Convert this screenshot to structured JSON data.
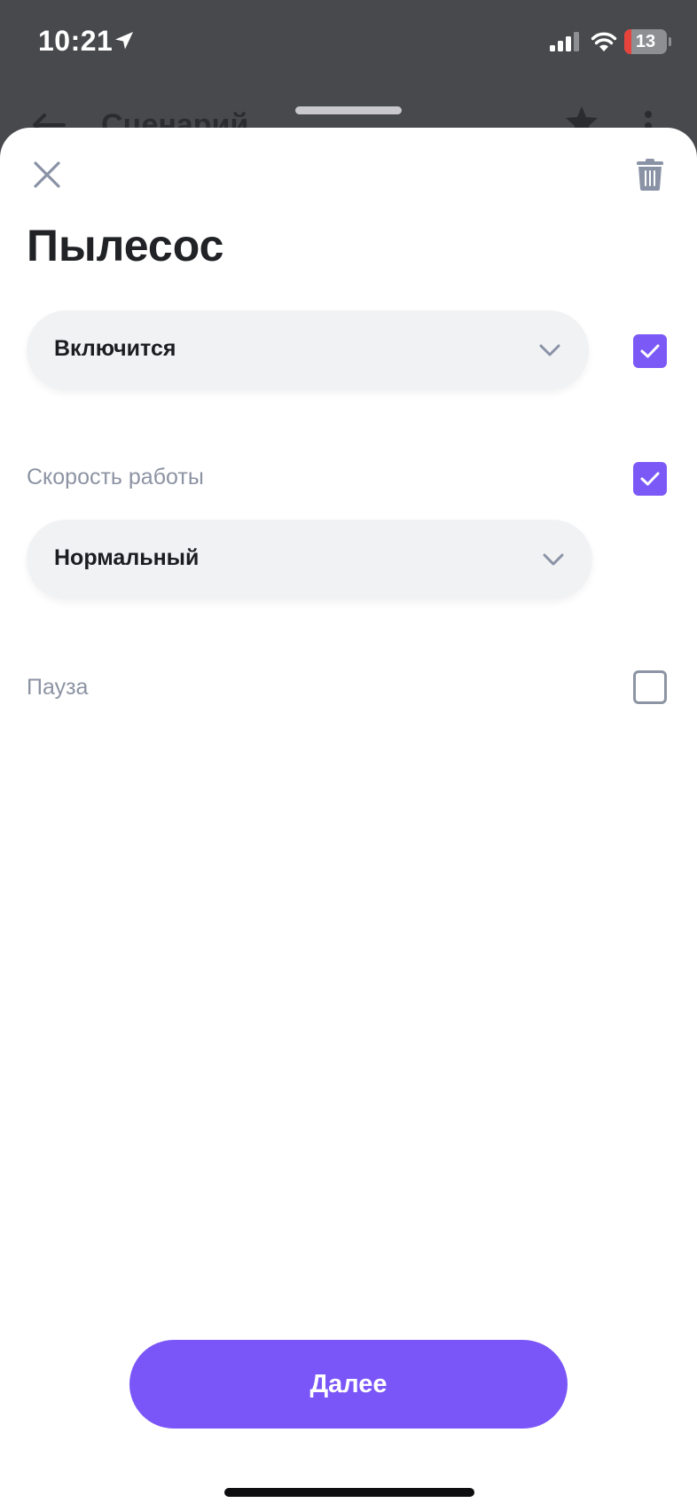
{
  "status_bar": {
    "time": "10:21",
    "location_icon": "location-arrow-icon",
    "signal_icon": "cellular-signal-icon",
    "wifi_icon": "wifi-icon",
    "battery_level": "13",
    "battery_color": "#e5433c"
  },
  "background_screen": {
    "title": "Сценарий",
    "back_icon": "arrow-left-icon",
    "star_icon": "star-icon",
    "more_icon": "more-vertical-icon"
  },
  "sheet": {
    "close_icon": "close-icon",
    "delete_icon": "trash-icon",
    "title": "Пылесос",
    "action_select": {
      "value": "Включится",
      "checked": true
    },
    "speed": {
      "label": "Скорость работы",
      "value": "Нормальный",
      "checked": true
    },
    "pause": {
      "label": "Пауза",
      "checked": false
    },
    "next_button": "Далее"
  },
  "colors": {
    "accent": "#7a56f8",
    "checkbox_checked": "#7b59f6",
    "label_muted": "#8c93a3",
    "select_bg": "#f1f2f4",
    "backdrop": "#48494d"
  }
}
